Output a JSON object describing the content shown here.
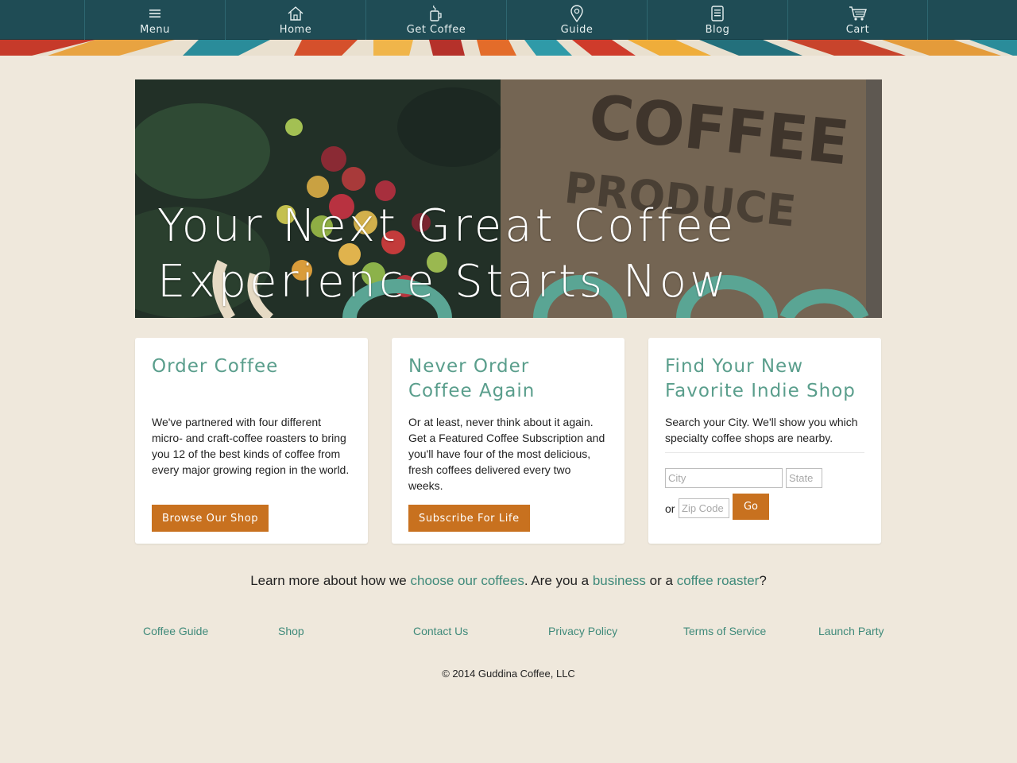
{
  "nav": {
    "items": [
      {
        "label": "Menu",
        "icon": "hamburger-icon"
      },
      {
        "label": "Home",
        "icon": "home-icon"
      },
      {
        "label": "Get Coffee",
        "icon": "coffee-cup-icon"
      },
      {
        "label": "Guide",
        "icon": "map-pin-icon"
      },
      {
        "label": "Blog",
        "icon": "document-icon"
      },
      {
        "label": "Cart",
        "icon": "cart-icon"
      }
    ]
  },
  "hero": {
    "line1": "Your Next Great Coffee",
    "line2": "Experience Starts Now"
  },
  "cards": {
    "order": {
      "title": "Order Coffee",
      "body": "We've partnered with four different micro- and craft-coffee roasters to bring you 12 of the best kinds of coffee from every major growing region in the world.",
      "button": "Browse Our Shop"
    },
    "subscribe": {
      "title_line1": "Never Order",
      "title_line2": "Coffee Again",
      "body": "Or at least, never think about it again. Get a Featured Coffee Subscription and you'll have four of the most delicious, fresh coffees delivered every two weeks.",
      "button": "Subscribe For Life"
    },
    "find": {
      "title_line1": "Find Your New",
      "title_line2": "Favorite Indie Shop",
      "body": "Search your City. We'll show you which specialty coffee shops are nearby.",
      "city_placeholder": "City",
      "state_placeholder": "State",
      "or_label": "or",
      "zip_placeholder": "Zip Code",
      "go_label": "Go"
    }
  },
  "learn": {
    "t1": "Learn more about how we ",
    "link1": "choose our coffees",
    "t2": ". Are you a ",
    "link2": "business",
    "t3": " or a ",
    "link3": "coffee roaster",
    "t4": "?"
  },
  "footer": {
    "links": [
      "Coffee Guide",
      "Shop",
      "Contact Us",
      "Privacy Policy",
      "Terms of Service",
      "Launch Party"
    ],
    "copyright": "© 2014 Guddina Coffee, LLC"
  },
  "colors": {
    "nav_bg": "#1f4c55",
    "accent_teal": "#5a9e8c",
    "button_orange": "#c8711f",
    "page_bg": "#efe8dc"
  }
}
